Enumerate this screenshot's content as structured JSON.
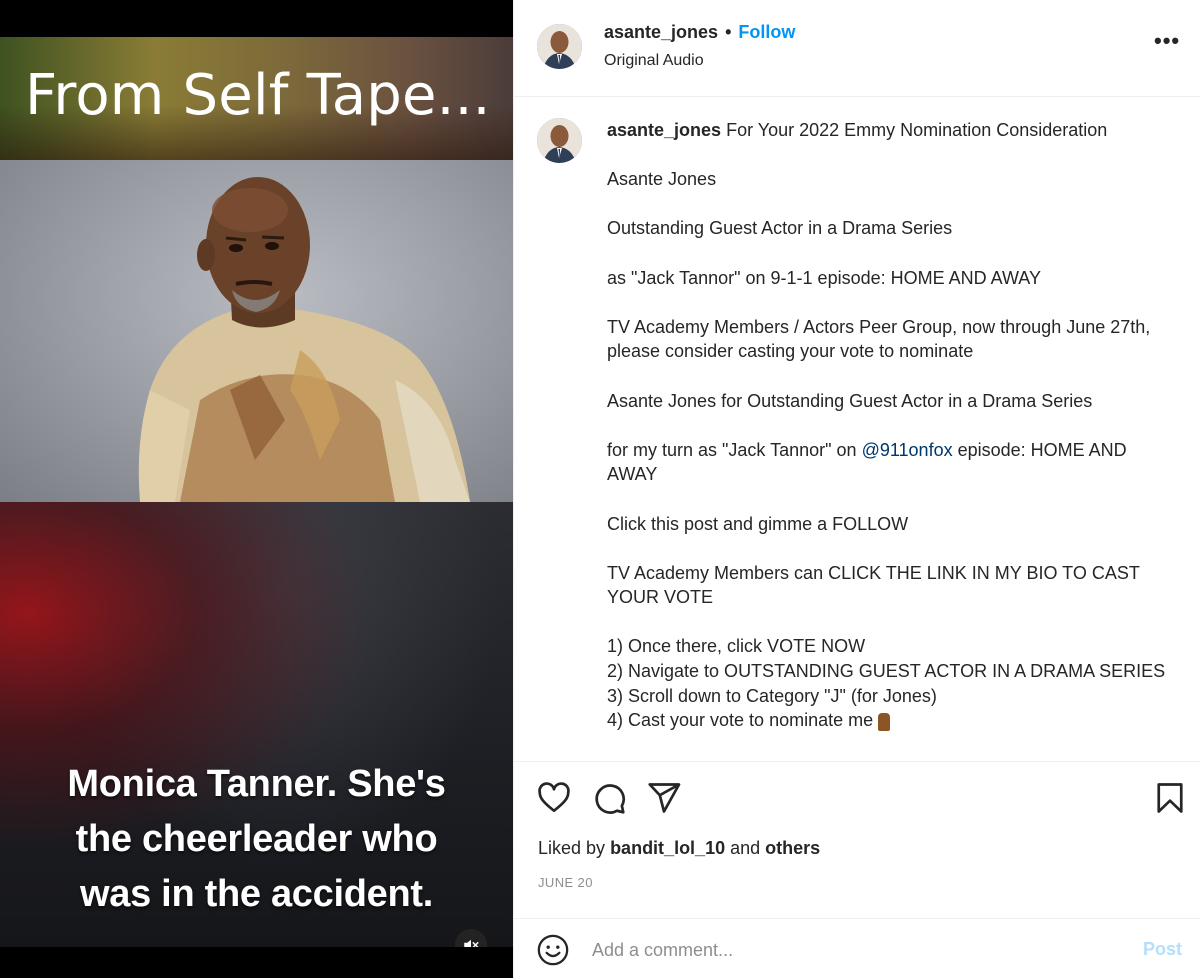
{
  "video": {
    "title_overlay": "From Self Tape...",
    "caption_lines": [
      "Monica Tanner. She's",
      "the cheerleader who",
      "was in the accident."
    ],
    "mute_icon": "speaker-muted-icon"
  },
  "header": {
    "username": "asante_jones",
    "separator": "•",
    "follow_label": "Follow",
    "audio_label": "Original Audio",
    "more_label": "•••"
  },
  "caption": {
    "username": "asante_jones",
    "first_line": "For Your 2022 Emmy Nomination Consideration",
    "paragraphs": [
      "Asante Jones",
      "Outstanding Guest Actor in a Drama Series",
      "as \"Jack Tannor\" on 9-1-1 episode: HOME AND AWAY",
      "TV Academy Members / Actors Peer Group, now through June 27th, please consider casting your vote to nominate",
      "Asante Jones for Outstanding Guest Actor in a Drama Series"
    ],
    "turn_prefix": "for my turn as \"Jack Tannor\" on",
    "mention": "@911onfox",
    "turn_suffix": "episode: HOME AND AWAY",
    "follow_line": "Click this post and gimme a FOLLOW",
    "vote_line": "TV Academy Members can CLICK THE LINK IN MY BIO TO CAST YOUR VOTE",
    "steps": [
      "1) Once there, click VOTE NOW",
      "2) Navigate to OUTSTANDING GUEST ACTOR IN A DRAMA SERIES",
      "3) Scroll down to Category \"J\" (for Jones)",
      "4) Cast your vote to nominate me"
    ]
  },
  "actions": {
    "icons": [
      "heart-icon",
      "comment-icon",
      "share-icon",
      "bookmark-icon"
    ]
  },
  "likes": {
    "prefix": "Liked by",
    "user": "bandit_lol_10",
    "middle": "and",
    "others": "others"
  },
  "date": "JUNE 20",
  "comment_box": {
    "placeholder": "Add a comment...",
    "post_label": "Post"
  },
  "colors": {
    "accent": "#0095f6",
    "post_disabled": "#b2dffc",
    "mention": "#00376b"
  }
}
